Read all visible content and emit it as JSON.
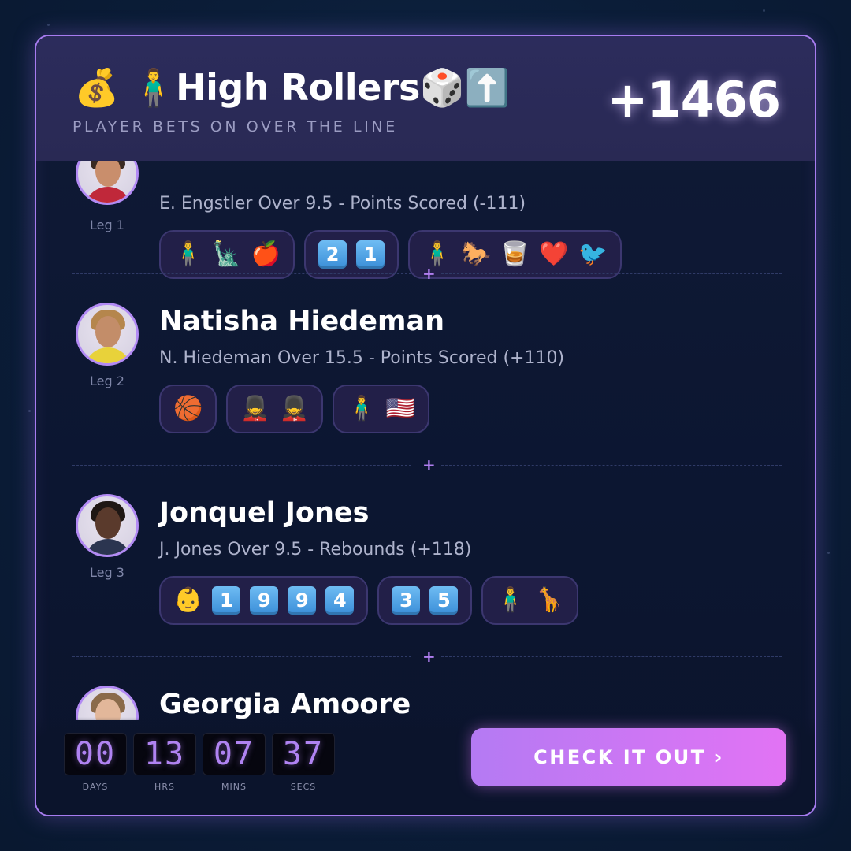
{
  "header": {
    "title": "💰 🧍‍♂️High Rollers🎲⬆️",
    "subtitle": "PLAYER BETS ON OVER THE LINE",
    "odds": "+1466"
  },
  "legs": [
    {
      "leg_label": "Leg 1",
      "name": "",
      "bet": "E. Engstler Over 9.5 - Points Scored (-111)",
      "chips": [
        {
          "items": [
            "🧍‍♂️",
            "🗽",
            "🍎"
          ]
        },
        {
          "keycaps": [
            "2",
            "1"
          ]
        },
        {
          "items": [
            "🧍‍♂️",
            "🐎",
            "🥃",
            "❤️",
            "🐦"
          ]
        }
      ]
    },
    {
      "leg_label": "Leg 2",
      "name": "Natisha Hiedeman",
      "bet": "N. Hiedeman Over 15.5 - Points Scored (+110)",
      "chips": [
        {
          "items": [
            "🏀"
          ]
        },
        {
          "items": [
            "💂",
            "💂"
          ]
        },
        {
          "items": [
            "🧍‍♂️",
            "🇺🇸"
          ]
        }
      ]
    },
    {
      "leg_label": "Leg 3",
      "name": "Jonquel Jones",
      "bet": "J. Jones Over 9.5 - Rebounds (+118)",
      "chips": [
        {
          "items": [
            "👶"
          ],
          "keycaps": [
            "1",
            "9",
            "9",
            "4"
          ]
        },
        {
          "keycaps": [
            "3",
            "5"
          ]
        },
        {
          "items": [
            "🧍‍♂️",
            "🦒"
          ]
        }
      ]
    },
    {
      "leg_label": "",
      "name": "Georgia Amoore",
      "bet": "",
      "chips": []
    }
  ],
  "divider_symbol": "+",
  "timer": {
    "days": "00",
    "hrs": "13",
    "mins": "07",
    "secs": "37",
    "days_label": "DAYS",
    "hrs_label": "HRS",
    "mins_label": "MINS",
    "secs_label": "SECS"
  },
  "cta": {
    "label": "CHECK IT OUT ›"
  },
  "colors": {
    "accent": "#b07ef0",
    "cta_start": "#b47af3",
    "cta_end": "#e273f4",
    "keycap": "#4a9ee4"
  }
}
